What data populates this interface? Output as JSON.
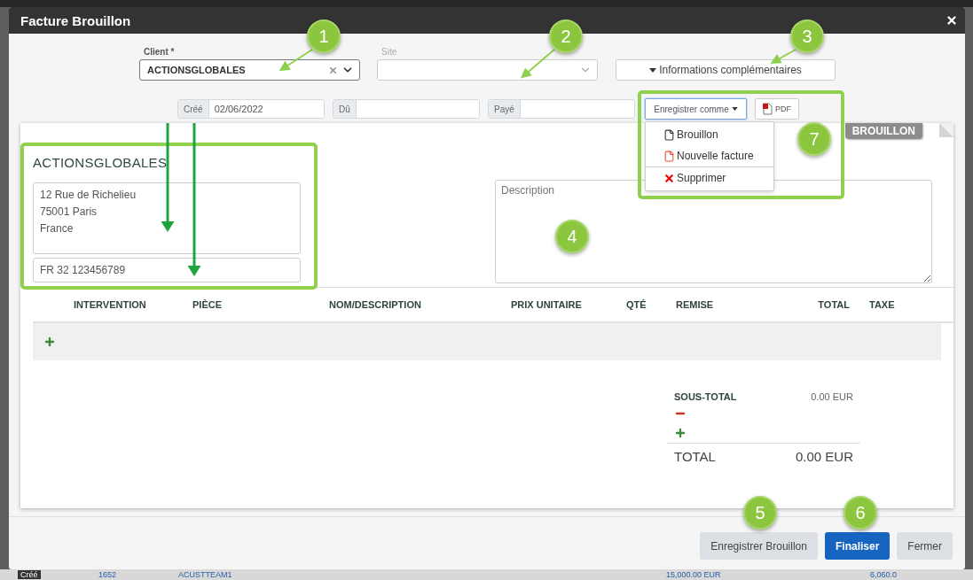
{
  "window": {
    "title": "Facture Brouillon"
  },
  "client": {
    "label": "Client *",
    "value": "ACTIONSGLOBALES"
  },
  "site": {
    "label": "Site"
  },
  "more_info_button": "Informations complémentaires",
  "dates": [
    {
      "label": "Créé",
      "value": "02/06/2022"
    },
    {
      "label": "Dû"
    },
    {
      "label": "Payé"
    }
  ],
  "save_as": {
    "label": "Enregistrer comme",
    "expanded": true,
    "items": [
      {
        "label": "Brouillon",
        "kind": "draft"
      },
      {
        "label": "Nouvelle facture",
        "kind": "invoice"
      },
      {
        "label": "Supprimer",
        "kind": "delete"
      }
    ]
  },
  "pdf_button": "PDF",
  "status_badge": "BROUILLON",
  "customer": {
    "name": "ACTIONSGLOBALES",
    "address": "12 Rue de Richelieu\n75001 Paris\nFrance",
    "vat": "FR 32 123456789"
  },
  "description": {
    "placeholder": "Description"
  },
  "table": {
    "columns": [
      "INTERVENTION",
      "PIÈCE",
      "NOM/DESCRIPTION",
      "PRIX UNITAIRE",
      "QTÉ",
      "REMISE",
      "TOTAL",
      "TAXE"
    ]
  },
  "totals": {
    "subtotal_label": "SOUS-TOTAL",
    "subtotal": "0.00 EUR",
    "total_label": "TOTAL",
    "total": "0.00 EUR"
  },
  "footer_buttons": [
    {
      "label": "Enregistrer Brouillon",
      "kind": "secondary"
    },
    {
      "label": "Finaliser",
      "kind": "primary"
    },
    {
      "label": "Fermer",
      "kind": "secondary"
    }
  ],
  "callouts": [
    "1",
    "2",
    "3",
    "4",
    "5",
    "6",
    "7"
  ],
  "background_row": [
    "Créé",
    "1652",
    "ACUSTTEAM1",
    "15,000.00 EUR",
    "6,060.0"
  ]
}
